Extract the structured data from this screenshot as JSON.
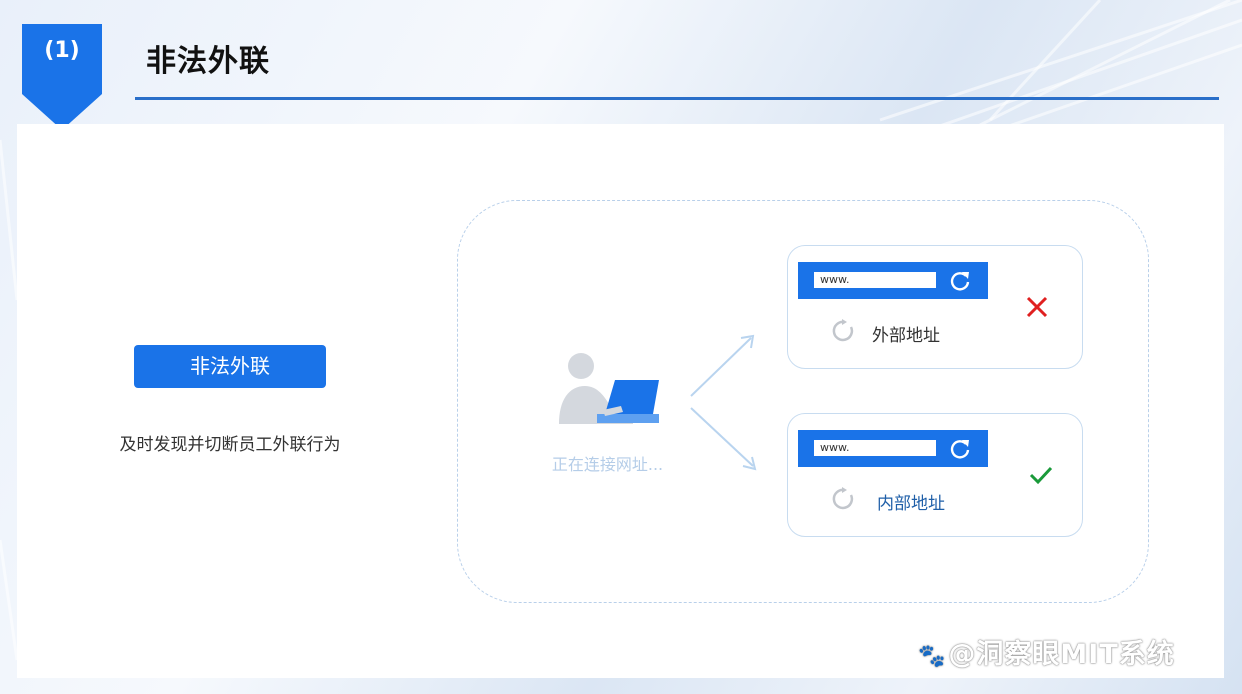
{
  "header": {
    "section_number": "(1)",
    "title": "非法外联"
  },
  "feature": {
    "button_label": "非法外联",
    "description": "及时发现并切断员工外联行为"
  },
  "diagram": {
    "connecting_text": "正在连接网址...",
    "external": {
      "url_text": "www.",
      "label": "外部地址",
      "status": "blocked",
      "status_color": "#e02020"
    },
    "internal": {
      "url_text": "www.",
      "label": "内部地址",
      "status": "allowed",
      "status_color": "#1a9a3a"
    }
  },
  "watermark": {
    "text": "@洞察眼MIT系统"
  },
  "colors": {
    "accent": "#1a73e8",
    "rule": "#2a6fc9"
  }
}
